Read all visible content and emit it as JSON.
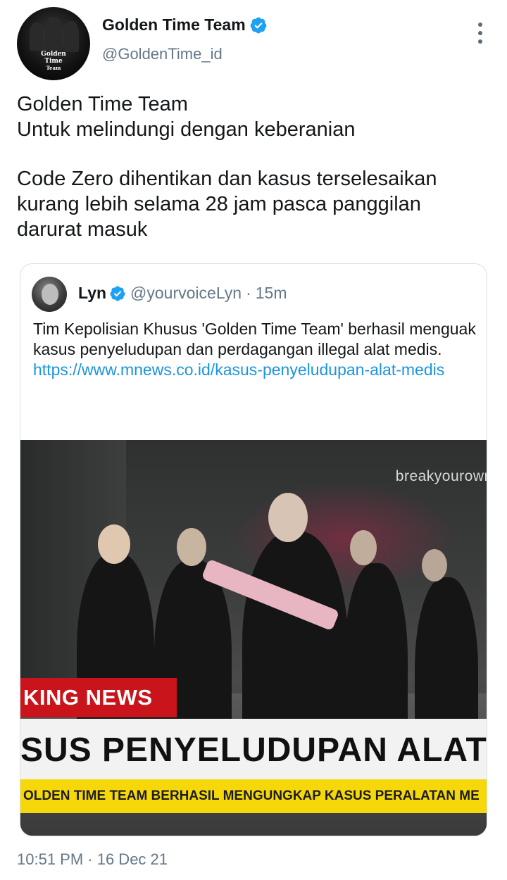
{
  "tweet": {
    "author": {
      "display_name": "Golden Time Team",
      "handle": "@GoldenTime_id",
      "verified": true,
      "avatar_logo_lines": [
        "Golden",
        "Time",
        "Team"
      ]
    },
    "text_paragraphs": [
      "Golden Time Team\nUntuk melindungi dengan keberanian",
      "Code Zero dihentikan dan kasus terselesaikan\nkurang lebih selama 28 jam pasca panggilan\ndarurat masuk"
    ],
    "timestamp": "10:51 PM · 16 Dec 21",
    "more_icon": "more-vertical-icon"
  },
  "quoted": {
    "display_name": "Lyn",
    "handle": "@yourvoiceLyn",
    "separator": "·",
    "time": "15m",
    "verified": true,
    "text": "Tim Kepolisian Khusus 'Golden Time Team' berhasil menguak kasus penyeludupan dan perdagangan illegal alat medis.",
    "link": "https://www.mnews.co.id/kasus-penyeludupan-alat-medis",
    "media": {
      "watermark": "breakyourowr",
      "red_banner": "KING NEWS",
      "headline": "SUS PENYELUDUPAN ALAT I",
      "ticker": "OLDEN TIME TEAM BERHASIL MENGUNGKAP KASUS PERALATAN ME"
    }
  },
  "colors": {
    "verified": "#1da1f2",
    "link": "#1b95e0",
    "secondary_text": "#657786",
    "breaking_red": "#c8141a",
    "ticker_yellow": "#f6d80a"
  }
}
